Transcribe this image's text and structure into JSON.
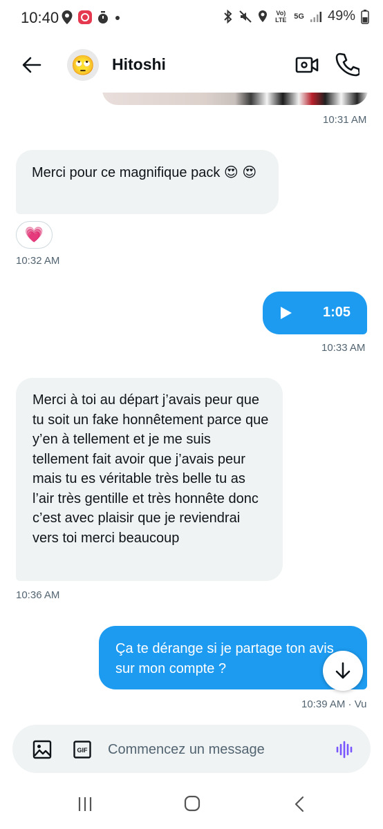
{
  "status_bar": {
    "time": "10:40",
    "signal_label": "Vo) LTE",
    "network": "5G",
    "battery": "49%",
    "icons": [
      "location-icon",
      "app-notification-icon",
      "timer-icon",
      "dot-icon",
      "bluetooth-icon",
      "mute-icon",
      "location-icon",
      "signal-icon",
      "battery-icon"
    ]
  },
  "header": {
    "contact_name": "Hitoshi",
    "avatar_emoji": "🙄",
    "back_icon": "arrow-left-icon",
    "video_icon": "video-call-icon",
    "call_icon": "phone-icon"
  },
  "conversation": {
    "media_time": "10:31 AM",
    "msg1_text": "Merci pour ce magnifique pack 😍 😍",
    "msg1_reaction": "💗",
    "msg1_time": "10:32 AM",
    "audio_duration": "1:05",
    "audio_time": "10:33 AM",
    "msg2_text": "Merci à toi au départ j’avais peur que tu soit un fake honnêtement parce que y’en à tellement et je me suis tellement fait avoir que j’avais peur mais tu es véritable très belle tu as l’air très gentille et très honnête donc c’est avec plaisir que je reviendrai vers toi merci beaucoup",
    "msg2_time": "10:36 AM",
    "msg3_text": "Ça te dérange si je partage ton avis sur mon compte ?",
    "msg3_time": "10:39 AM · Vu"
  },
  "composer": {
    "placeholder": "Commencez un message",
    "gif_label": "GIF"
  },
  "colors": {
    "accent": "#1d9bf0",
    "incoming_bubble": "#eff3f4",
    "secondary_text": "#536471",
    "voice_icon": "#7856ff"
  }
}
